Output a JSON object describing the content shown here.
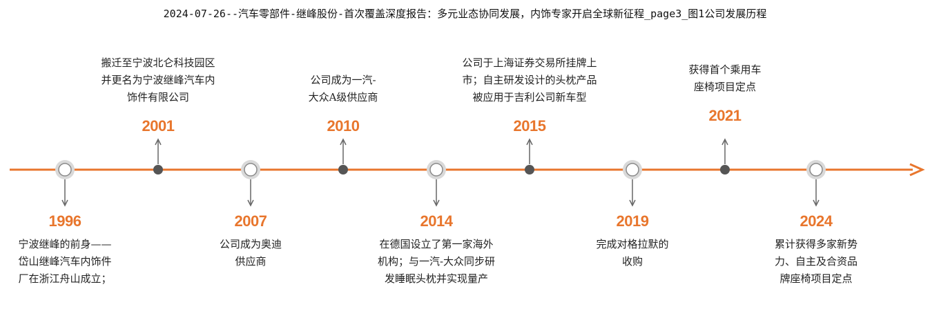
{
  "title": "2024-07-26--汽车零部件-继峰股份-首次覆盖深度报告：多元业态协同发展，内饰专家开启全球新征程_page3_图1公司发展历程",
  "colors": {
    "accent": "#e8762d",
    "node_dark": "#555555",
    "ring": "#d9d9d9",
    "arrow": "#666666"
  },
  "events": [
    {
      "year": "1996",
      "side": "below",
      "marker": "ring",
      "lines": [
        "宁波继峰的前身——",
        "岱山继峰汽车内饰件",
        "厂在浙江舟山成立；"
      ]
    },
    {
      "year": "2001",
      "side": "above",
      "marker": "dot",
      "lines": [
        "搬迁至宁波北仑科技园区",
        "并更名为宁波继峰汽车内",
        "饰件有限公司"
      ]
    },
    {
      "year": "2007",
      "side": "below",
      "marker": "ring",
      "lines": [
        "公司成为奥迪",
        "供应商"
      ]
    },
    {
      "year": "2010",
      "side": "above",
      "marker": "dot",
      "lines": [
        "公司成为一汽-",
        "大众A级供应商"
      ]
    },
    {
      "year": "2014",
      "side": "below",
      "marker": "ring",
      "lines": [
        "在德国设立了第一家海外",
        "机构；与一汽-大众同步研",
        "发睡眠头枕并实现量产"
      ]
    },
    {
      "year": "2015",
      "side": "above",
      "marker": "dot",
      "lines": [
        "公司于上海证券交易所挂牌上",
        "市；自主研发设计的头枕产品",
        "被应用于吉利公司新车型"
      ]
    },
    {
      "year": "2019",
      "side": "below",
      "marker": "ring",
      "lines": [
        "完成对格拉默的",
        "收购"
      ]
    },
    {
      "year": "2021",
      "side": "above",
      "marker": "dot",
      "lines": [
        "获得首个乘用车",
        "座椅项目定点"
      ]
    },
    {
      "year": "2024",
      "side": "below",
      "marker": "ring",
      "lines": [
        "累计获得多家新势",
        "力、自主及合资品",
        "牌座椅项目定点"
      ]
    }
  ]
}
